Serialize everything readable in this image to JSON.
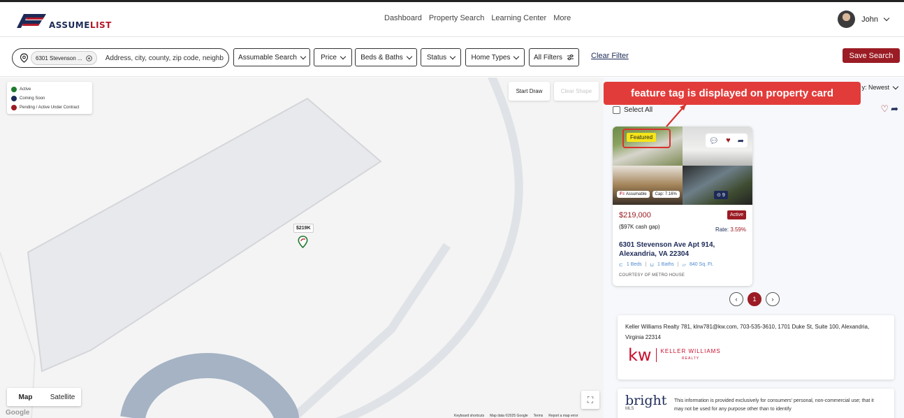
{
  "header": {
    "logo_prefix": "ASSUME",
    "logo_suffix": "LIST",
    "nav": [
      "Dashboard",
      "Property Search",
      "Learning Center",
      "More"
    ],
    "user_name": "John"
  },
  "filters": {
    "location_chip": "6301 Stevenson ...",
    "search_placeholder": "Address, city, county, zip code, neighb",
    "buttons": [
      "Assumable Search",
      "Price",
      "Beds & Baths",
      "Status",
      "Home Types",
      "All Filters"
    ],
    "clear_label": "Clear Filter",
    "save_label": "Save Search"
  },
  "map": {
    "legend": [
      {
        "label": "Active",
        "color": "#1f7a2e"
      },
      {
        "label": "Coming Soon",
        "color": "#1d2a57"
      },
      {
        "label": "Pending / Active Under Contract",
        "color": "#9b1c24"
      }
    ],
    "start_draw": "Start Draw",
    "clear_shape": "Clear Shape",
    "price_pin": "$219K",
    "map_type": [
      "Map",
      "Satellite"
    ],
    "google": "Google",
    "credits": [
      "Keyboard shortcuts",
      "Map data ©2025 Google",
      "Terms",
      "Report a map error"
    ]
  },
  "results": {
    "sort_label": "y: Newest",
    "select_all": "Select All",
    "annotation": "feature tag is displayed on property card",
    "card": {
      "featured_tag": "Featured",
      "assumable_badge": "Assumable",
      "cap_badge": "Cap: 7.16%",
      "image_count": "9",
      "price": "$219,000",
      "cash_gap": "($97K cash gap)",
      "status": "Active",
      "rate_label": "Rate:",
      "rate_value": "3.59%",
      "address_line1": "6301 Stevenson Ave Apt 914,",
      "address_line2": "Alexandria, VA 22304",
      "beds": "1 Beds",
      "baths": "1 Baths",
      "sqft": "840 Sq. Ft.",
      "courtesy": "COURTESY OF METRO HOUSE"
    },
    "pagination": {
      "current": "1"
    },
    "agent_info": "Keller Williams Realty 781, klrw781@kw.com, 703-535-3610, 1701 Duke St, Suite 100, Alexandria, Virginia 22314",
    "kw_logo": {
      "mark": "kw",
      "name": "KELLER WILLIAMS",
      "sub": "REALTY"
    },
    "bright": {
      "logo": "bright",
      "sub": "MLS",
      "text": "This information is provided exclusively for consumers' personal, non-commercial use; that it may not be used for any purpose other than to identify"
    }
  }
}
